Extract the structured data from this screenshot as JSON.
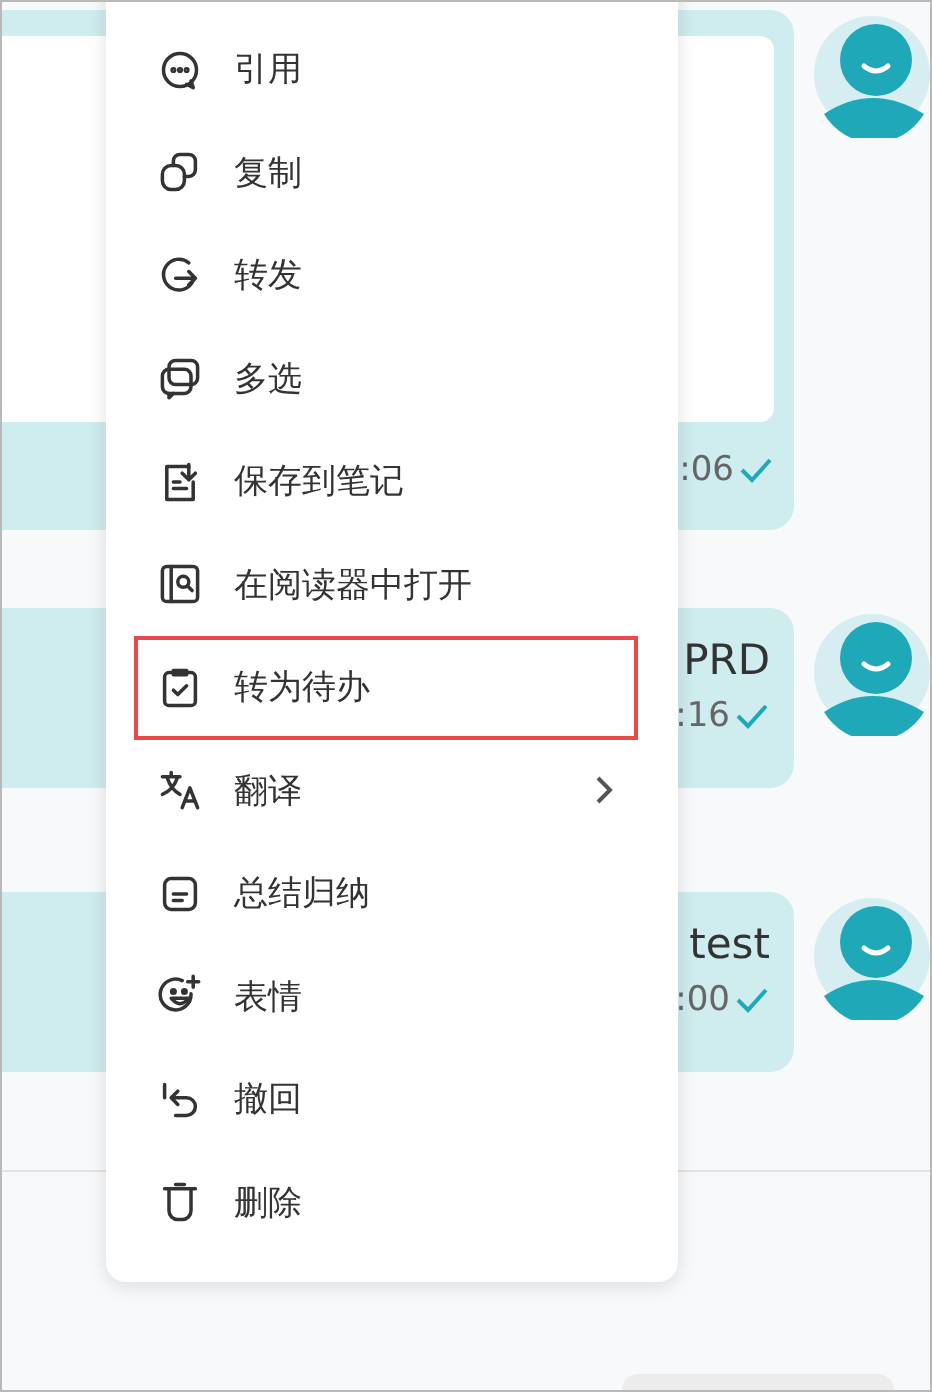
{
  "messages": [
    {
      "time": ":06",
      "read": true,
      "kind": "card"
    },
    {
      "text": "PRD",
      "time": ":16",
      "read": true,
      "kind": "text"
    },
    {
      "text": "test",
      "time": ":00",
      "read": true,
      "kind": "text"
    }
  ],
  "context_menu": {
    "items": [
      {
        "label": "引用",
        "kind": "plain",
        "highlighted": false
      },
      {
        "label": "复制",
        "kind": "plain",
        "highlighted": false
      },
      {
        "label": "转发",
        "kind": "plain",
        "highlighted": false
      },
      {
        "label": "多选",
        "kind": "plain",
        "highlighted": false
      },
      {
        "label": "保存到笔记",
        "kind": "plain",
        "highlighted": false
      },
      {
        "label": "在阅读器中打开",
        "kind": "plain",
        "highlighted": false
      },
      {
        "label": "转为待办",
        "kind": "plain",
        "highlighted": true
      },
      {
        "label": "翻译",
        "kind": "submenu",
        "highlighted": false
      },
      {
        "label": "总结归纳",
        "kind": "plain",
        "highlighted": false
      },
      {
        "label": "表情",
        "kind": "plain",
        "highlighted": false
      },
      {
        "label": "撤回",
        "kind": "plain",
        "highlighted": false
      },
      {
        "label": "删除",
        "kind": "plain",
        "highlighted": false
      }
    ]
  }
}
